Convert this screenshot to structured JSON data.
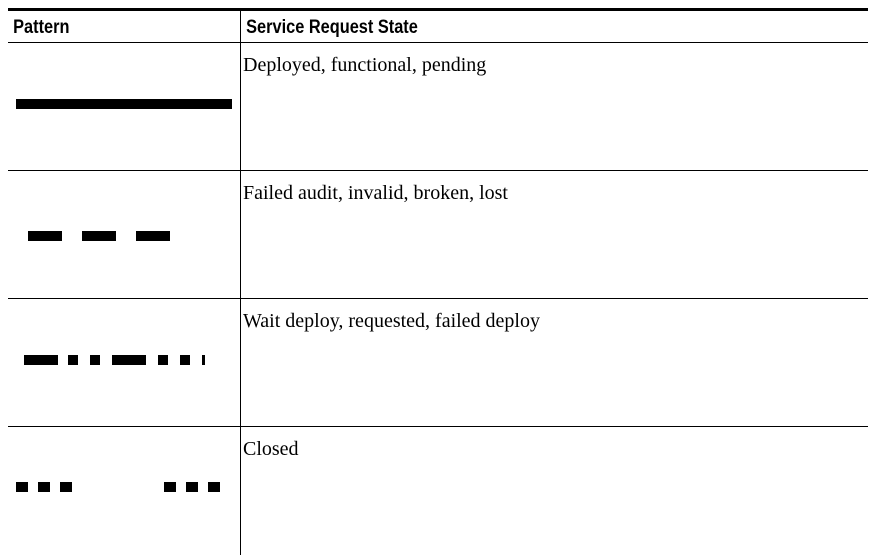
{
  "table": {
    "headers": {
      "pattern": "Pattern",
      "state": "Service Request State"
    },
    "rows": [
      {
        "pattern": "solid-line",
        "state": "Deployed, functional, pending"
      },
      {
        "pattern": "dashed-line",
        "state": "Failed audit, invalid, broken, lost"
      },
      {
        "pattern": "dash-dot-line",
        "state": "Wait deploy, requested, failed deploy"
      },
      {
        "pattern": "dotted-gap-line",
        "state": "Closed"
      }
    ]
  }
}
